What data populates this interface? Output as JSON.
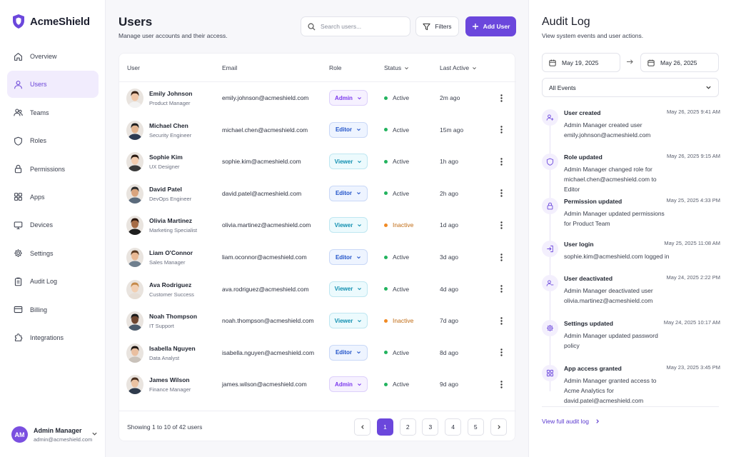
{
  "brand": {
    "name": "AcmeShield"
  },
  "nav": [
    {
      "label": "Overview",
      "icon": "home-icon",
      "active": false
    },
    {
      "label": "Users",
      "icon": "user-icon",
      "active": true
    },
    {
      "label": "Teams",
      "icon": "team-icon",
      "active": false
    },
    {
      "label": "Roles",
      "icon": "shield-icon",
      "active": false
    },
    {
      "label": "Permissions",
      "icon": "lock-icon",
      "active": false
    },
    {
      "label": "Apps",
      "icon": "grid-icon",
      "active": false
    },
    {
      "label": "Devices",
      "icon": "monitor-icon",
      "active": false
    },
    {
      "label": "Settings",
      "icon": "gear-icon",
      "active": false
    },
    {
      "label": "Audit Log",
      "icon": "clipboard-icon",
      "active": false
    },
    {
      "label": "Billing",
      "icon": "credit-card-icon",
      "active": false
    },
    {
      "label": "Integrations",
      "icon": "puzzle-icon",
      "active": false
    }
  ],
  "profile": {
    "initials": "AM",
    "name": "Admin Manager",
    "email": "admin@acmeshield.com"
  },
  "header": {
    "title": "Users",
    "subtitle": "Manage user accounts and their access.",
    "search_placeholder": "Search users...",
    "filters_label": "Filters",
    "add_label": "Add User"
  },
  "table": {
    "headers": {
      "user": "User",
      "email": "Email",
      "role": "Role",
      "status": "Status",
      "last_active": "Last Active"
    },
    "rows": [
      {
        "name": "Emily Johnson",
        "title": "Product Manager",
        "email": "emily.johnson@acmeshield.com",
        "role": "Admin",
        "status": "Active",
        "last_active": "2m ago"
      },
      {
        "name": "Michael Chen",
        "title": "Security Engineer",
        "email": "michael.chen@acmeshield.com",
        "role": "Editor",
        "status": "Active",
        "last_active": "15m ago"
      },
      {
        "name": "Sophie Kim",
        "title": "UX Designer",
        "email": "sophie.kim@acmeshield.com",
        "role": "Viewer",
        "status": "Active",
        "last_active": "1h ago"
      },
      {
        "name": "David Patel",
        "title": "DevOps Engineer",
        "email": "david.patel@acmeshield.com",
        "role": "Editor",
        "status": "Active",
        "last_active": "2h ago"
      },
      {
        "name": "Olivia Martinez",
        "title": "Marketing Specialist",
        "email": "olivia.martinez@acmeshield.com",
        "role": "Viewer",
        "status": "Inactive",
        "last_active": "1d ago"
      },
      {
        "name": "Liam O'Connor",
        "title": "Sales Manager",
        "email": "liam.oconnor@acmeshield.com",
        "role": "Editor",
        "status": "Active",
        "last_active": "3d ago"
      },
      {
        "name": "Ava Rodriguez",
        "title": "Customer Success",
        "email": "ava.rodriguez@acmeshield.com",
        "role": "Viewer",
        "status": "Active",
        "last_active": "4d ago"
      },
      {
        "name": "Noah Thompson",
        "title": "IT Support",
        "email": "noah.thompson@acmeshield.com",
        "role": "Viewer",
        "status": "Inactive",
        "last_active": "7d ago"
      },
      {
        "name": "Isabella Nguyen",
        "title": "Data Analyst",
        "email": "isabella.nguyen@acmeshield.com",
        "role": "Editor",
        "status": "Active",
        "last_active": "8d ago"
      },
      {
        "name": "James Wilson",
        "title": "Finance Manager",
        "email": "james.wilson@acmeshield.com",
        "role": "Admin",
        "status": "Active",
        "last_active": "9d ago"
      }
    ],
    "showing": "Showing 1 to 10 of 42 users",
    "pages": [
      "1",
      "2",
      "3",
      "4",
      "5"
    ],
    "current_page": "1"
  },
  "colors": {
    "accent": "#6b47dc",
    "active": "#22b35e",
    "inactive": "#f08a24"
  },
  "audit": {
    "title": "Audit Log",
    "subtitle": "View system events and user actions.",
    "date_from": "May 19, 2025",
    "date_to": "May 26, 2025",
    "filter": "All Events",
    "events": [
      {
        "title": "User created",
        "date": "May 26, 2025 9:41 AM",
        "desc": "Admin Manager created user emily.johnson@acmeshield.com",
        "icon": "user-plus-icon"
      },
      {
        "title": "Role updated",
        "date": "May 26, 2025 9:15 AM",
        "desc": "Admin Manager changed role for michael.chen@acmeshield.com to Editor",
        "icon": "shield-icon"
      },
      {
        "title": "Permission updated",
        "date": "May 25, 2025 4:33 PM",
        "desc": "Admin Manager updated permissions for Product Team",
        "icon": "lock-icon"
      },
      {
        "title": "User login",
        "date": "May 25, 2025 11:08 AM",
        "desc": "sophie.kim@acmeshield.com logged in",
        "icon": "login-icon"
      },
      {
        "title": "User deactivated",
        "date": "May 24, 2025 2:22 PM",
        "desc": "Admin Manager deactivated user olivia.martinez@acmeshield.com",
        "icon": "user-minus-icon"
      },
      {
        "title": "Settings updated",
        "date": "May 24, 2025 10:17 AM",
        "desc": "Admin Manager updated password policy",
        "icon": "gear-icon"
      },
      {
        "title": "App access granted",
        "date": "May 23, 2025 3:45 PM",
        "desc": "Admin Manager granted access to Acme Analytics for david.patel@acmeshield.com",
        "icon": "grid-icon"
      }
    ],
    "view_full": "View full audit log"
  }
}
